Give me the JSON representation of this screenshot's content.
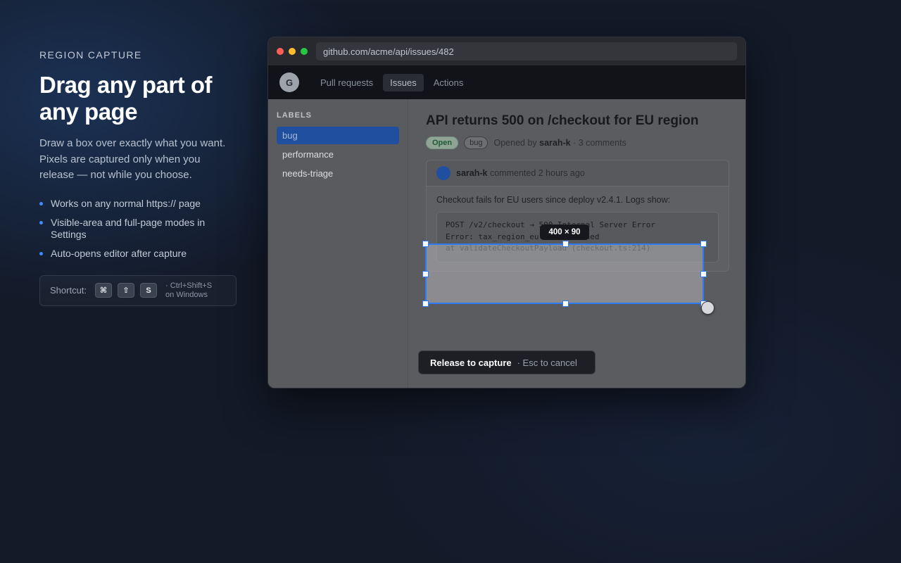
{
  "promo": {
    "eyebrow": "REGION CAPTURE",
    "headline": "Drag any part of any page",
    "description": "Draw a box over exactly what you want. Pixels are captured only when you release — not while you choose.",
    "bullets": [
      "Works on any normal https:// page",
      "Visible-area and full-page modes in Settings",
      "Auto-opens editor after capture"
    ],
    "shortcut": {
      "label": "Shortcut:",
      "keys": [
        "⌘",
        "⇧",
        "S"
      ],
      "note_line1": "· Ctrl+Shift+S",
      "note_line2": "on Windows"
    },
    "accent": "#3d8bff"
  },
  "browser": {
    "traffic_lights": [
      "#ff5f57",
      "#febc2e",
      "#28c840"
    ],
    "url": "github.com/acme/api/issues/482",
    "logo_letter": "G",
    "nav": [
      "Pull requests",
      "Issues",
      "Actions"
    ],
    "nav_active": "Issues",
    "sidebar": {
      "title": "LABELS",
      "labels": [
        "bug",
        "performance",
        "needs-triage"
      ],
      "active": "bug"
    },
    "issue": {
      "title": "API returns 500 on /checkout for EU region",
      "status": "Open",
      "tag": "bug",
      "opened_by_prefix": "Opened by",
      "author": "sarah-k",
      "comments": "· 3 comments"
    },
    "comment": {
      "author": "sarah-k",
      "action": "commented 2 hours ago",
      "text": "Checkout fails for EU users since deploy v2.4.1. Logs show:",
      "code_lines": [
        "POST /v2/checkout → 500 Internal Server Error",
        "Error: tax_region_eu is undefined",
        "at validateCheckoutPayload (checkout.ts:214)"
      ]
    }
  },
  "selection": {
    "size_label": "400 × 90",
    "color": "#2f7bf2"
  },
  "capture_bar": {
    "primary": "Release to capture",
    "secondary": "· Esc to cancel"
  }
}
